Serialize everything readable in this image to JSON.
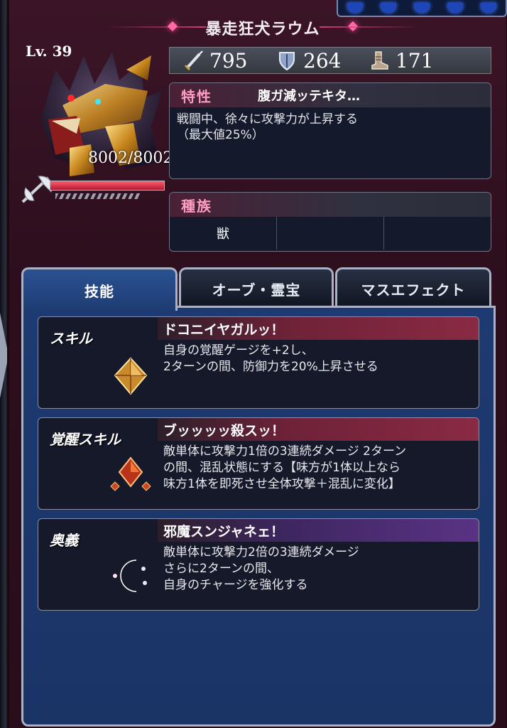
{
  "unit": {
    "name": "暴走狂犬ラウム",
    "level": "Lv. 39",
    "hp_text": "8002/8002",
    "hp_fraction": 1.0
  },
  "stats": {
    "attack": "795",
    "defense": "264",
    "speed": "171"
  },
  "trait": {
    "label": "特性",
    "name": "腹ガ減ッテキタ…",
    "desc": "戦闘中、徐々に攻撃力が上昇する\n（最大値25%）"
  },
  "race": {
    "label": "種族",
    "values": [
      "獣",
      "",
      ""
    ]
  },
  "tabs": [
    "技能",
    "オーブ・霊宝",
    "マスエフェクト"
  ],
  "active_tab": 0,
  "skills": [
    {
      "kind": "スキル",
      "name": "ドコニイヤガルッ！",
      "desc": "自身の覚醒ゲージを+2し、\n2ターンの間、防御力を20%上昇させる",
      "icon": "amber-crystal-icon"
    },
    {
      "kind": "覚醒スキル",
      "name": "ブッッッッ殺スッ！",
      "desc": "敵単体に攻撃力1倍の3連続ダメージ 2ターン\nの間、混乱状態にする【味方が1体以上なら\n味方1体を即死させ全体攻撃＋混乱に変化】",
      "icon": "red-crystal-cluster-icon"
    },
    {
      "kind": "奥義",
      "name": "邪魔スンジャネェ！",
      "desc": "敵単体に攻撃力2倍の3連続ダメージ\nさらに2ターンの間、\n自身のチャージを強化する",
      "icon": "rainbow-crescent-icon"
    }
  ],
  "colors": {
    "accent_pink": "#ff9cc2",
    "skill_bar_red": "#8a2a44",
    "skill_bar_purple": "#5a3384",
    "content_blue": "#1e3c72"
  }
}
